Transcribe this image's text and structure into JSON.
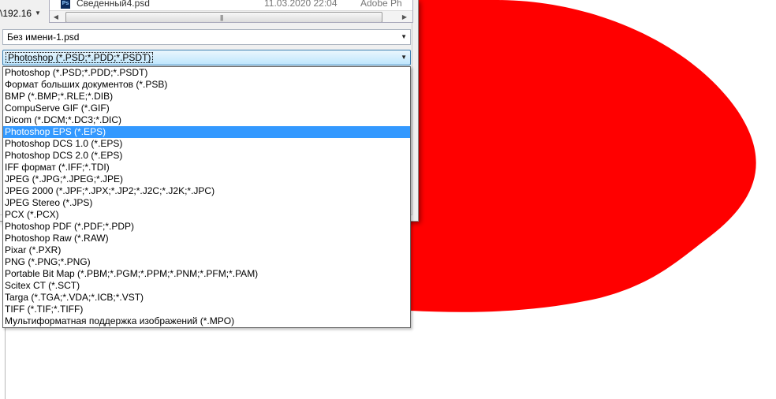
{
  "colors": {
    "canvas_shape": "#ff0000",
    "selection": "#3399ff",
    "background": "#ffffff"
  },
  "nav": {
    "path_text": "\\192.16",
    "dropdown_icon": "chevron-down-icon"
  },
  "file_list": {
    "row": {
      "icon": "photoshop-file-icon",
      "icon_text": "Ps",
      "name": "Сведенный4.psd",
      "date": "11.03.2020 22:04",
      "type": "Adobe Ph"
    }
  },
  "filename": {
    "value": "Без имени-1.psd"
  },
  "format": {
    "selected_value": "Photoshop (*.PSD;*.PDD;*.PSDT)",
    "options": [
      "Photoshop (*.PSD;*.PDD;*.PSDT)",
      "Формат больших документов (*.PSB)",
      "BMP (*.BMP;*.RLE;*.DIB)",
      "CompuServe GIF (*.GIF)",
      "Dicom (*.DCM;*.DC3;*.DIC)",
      "Photoshop EPS (*.EPS)",
      "Photoshop DCS 1.0 (*.EPS)",
      "Photoshop DCS 2.0 (*.EPS)",
      "IFF формат (*.IFF;*.TDI)",
      "JPEG (*.JPG;*.JPEG;*.JPE)",
      "JPEG 2000 (*.JPF;*.JPX;*.JP2;*.J2C;*.J2K;*.JPC)",
      "JPEG Stereo (*.JPS)",
      "PCX (*.PCX)",
      "Photoshop PDF (*.PDF;*.PDP)",
      "Photoshop Raw (*.RAW)",
      "Pixar (*.PXR)",
      "PNG (*.PNG;*.PNG)",
      "Portable Bit Map (*.PBM;*.PGM;*.PPM;*.PNM;*.PFM;*.PAM)",
      "Scitex CT (*.SCT)",
      "Targa (*.TGA;*.VDA;*.ICB;*.VST)",
      "TIFF (*.TIF;*.TIFF)",
      "Мультиформатная поддержка изображений  (*.MPO)"
    ],
    "highlighted_index": 5
  }
}
